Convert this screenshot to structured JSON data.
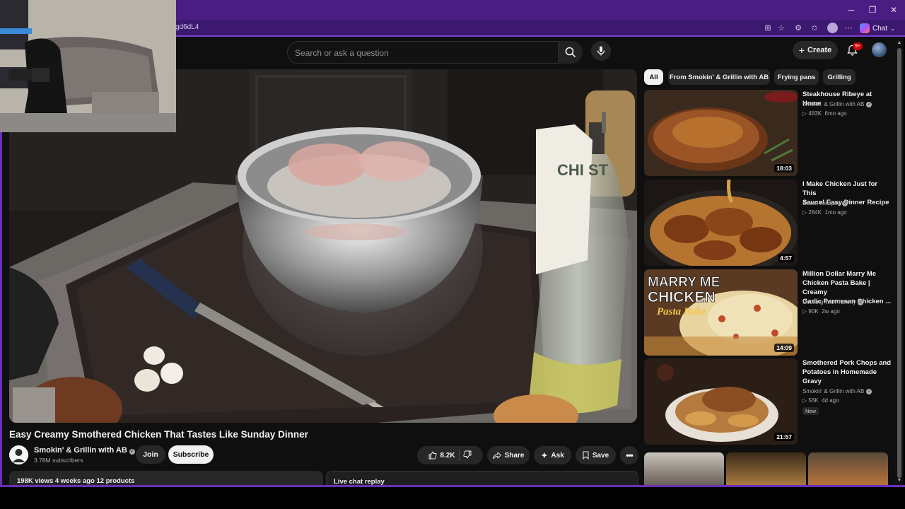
{
  "browser": {
    "url_fragment": "gd6dL4",
    "window_controls": {
      "minimize": "✕",
      "maximize": "✕",
      "close": "✕"
    },
    "copilot_label": "Chat"
  },
  "topbar": {
    "search_placeholder": "Search or ask a question",
    "create_label": "Create",
    "notification_badge": "9+"
  },
  "video": {
    "title": "Easy Creamy Smothered Chicken That Tastes Like Sunday Dinner",
    "channel": "Smokin' & Grillin with AB",
    "subscribers": "3.78M subscribers",
    "join_label": "Join",
    "subscribe_label": "Subscribe",
    "likes": "8.2K",
    "share_label": "Share",
    "ask_label": "Ask",
    "save_label": "Save",
    "description_line": "198K views  4 weeks ago  12 products",
    "live_chat_label": "Live chat replay"
  },
  "chips": [
    {
      "label": "All",
      "active": true
    },
    {
      "label": "From Smokin' & Grillin with AB",
      "active": false
    },
    {
      "label": "Frying pans",
      "active": false
    },
    {
      "label": "Grilling",
      "active": false
    }
  ],
  "recommendations": [
    {
      "title_l1": "Steakhouse Ribeye at Home",
      "title_l2": "",
      "title_l3": "",
      "channel": "Smokin' & Grillin with AB",
      "views": "483K",
      "age": "6mo ago",
      "duration": "18:03",
      "badge": ""
    },
    {
      "title_l1": "I Make Chicken Just for This",
      "title_l2": "Sauce! Easy Dinner Recipe",
      "title_l3": "",
      "channel": "Essen Recipes",
      "views": "284K",
      "age": "1mo ago",
      "duration": "4:57",
      "badge": ""
    },
    {
      "title_l1": "Million Dollar Marry Me",
      "title_l2": "Chicken Pasta Bake | Creamy",
      "title_l3": "Garlic Parmesan Chicken ...",
      "channel": "Cooking With Tammy",
      "views": "90K",
      "age": "2w ago",
      "duration": "14:09",
      "badge": "",
      "thumb_text_1": "MARRY ME",
      "thumb_text_2": "CHICKEN",
      "thumb_text_3": "Pasta Bake"
    },
    {
      "title_l1": "Smothered Pork Chops and",
      "title_l2": "Potatoes in Homemade",
      "title_l3": "Gravy",
      "channel": "Smokin' & Grillin with AB",
      "views": "56K",
      "age": "4d ago",
      "duration": "21:57",
      "badge": "New"
    }
  ],
  "packaging_text": "CHI ST"
}
